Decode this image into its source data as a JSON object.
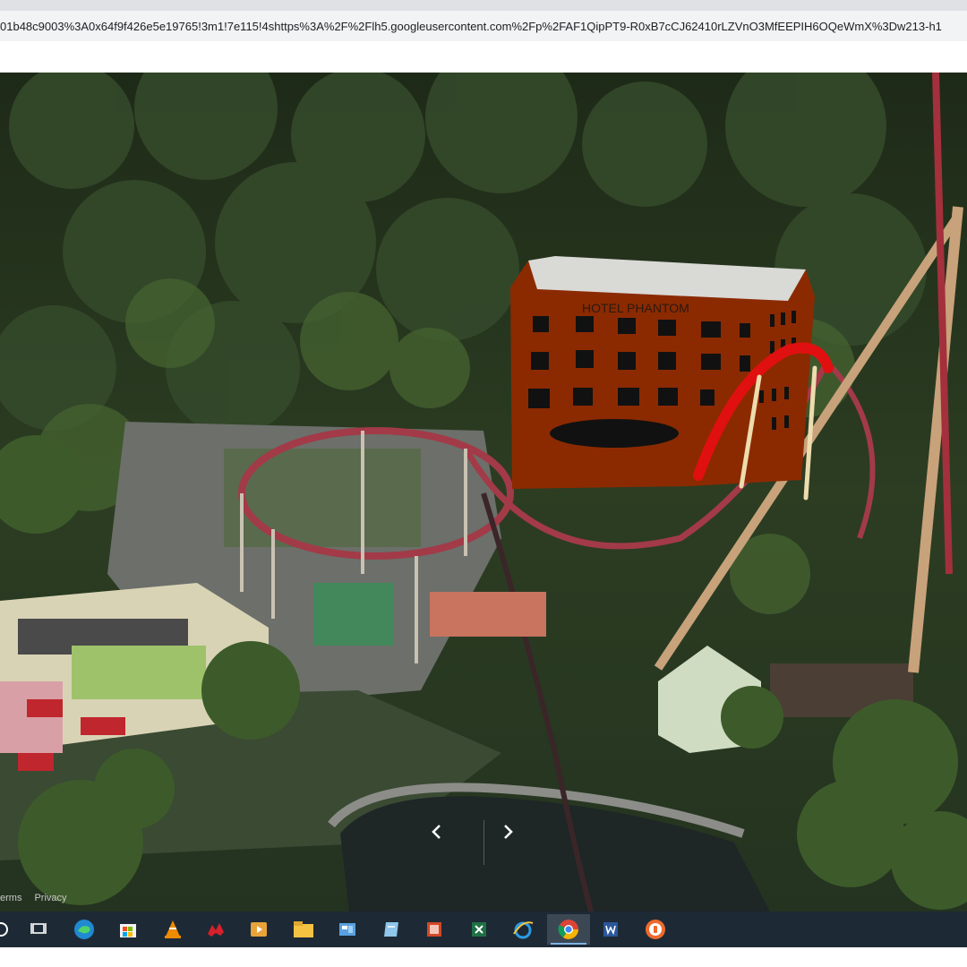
{
  "browser": {
    "url": "01b48c9003%3A0x64f9f426e5e19765!3m1!7e115!4shttps%3A%2F%2Flh5.googleusercontent.com%2Fp%2FAF1QipPT9-R0xB7cCJ62410rLZVnO3MfEEPIH6OQeWmX%3Dw213-h1"
  },
  "viewer": {
    "image_sign_text": "HOTEL PHANTOM",
    "prev_icon": "chevron-left-icon",
    "next_icon": "chevron-right-icon",
    "footer": {
      "terms": "erms",
      "privacy": "Privacy"
    }
  },
  "taskbar": {
    "icons": [
      "search-icon",
      "task-view-icon",
      "edge-icon",
      "store-icon",
      "vlc-icon",
      "red-app-icon",
      "media-player-icon",
      "file-explorer-icon",
      "control-panel-icon",
      "notepad-icon",
      "powerpoint-icon",
      "excel-icon",
      "internet-explorer-icon",
      "chrome-icon",
      "word-icon",
      "brave-icon"
    ],
    "active": "chrome-icon"
  }
}
